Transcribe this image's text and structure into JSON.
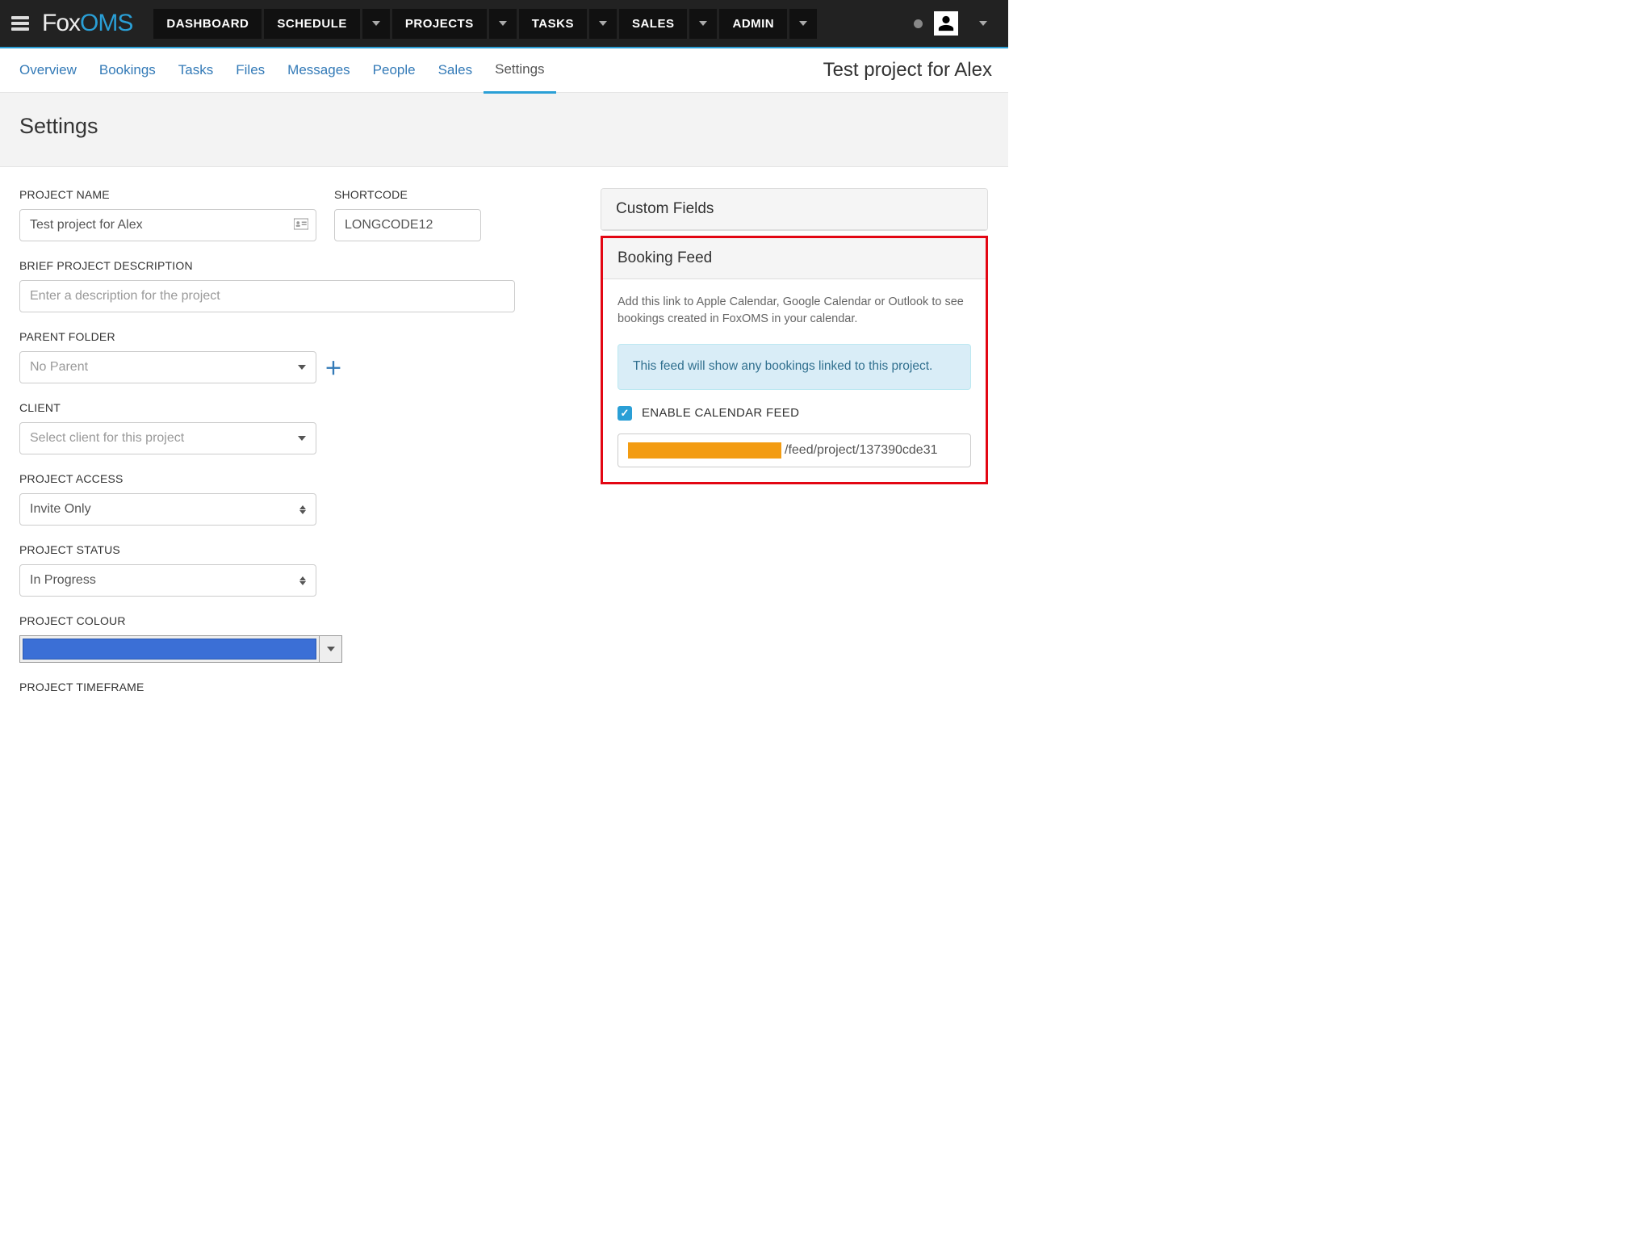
{
  "brand": {
    "part1": "Fox",
    "part2": "OMS"
  },
  "nav": {
    "items": [
      {
        "label": "DASHBOARD",
        "has_caret": false
      },
      {
        "label": "SCHEDULE",
        "has_caret": true
      },
      {
        "label": "PROJECTS",
        "has_caret": true
      },
      {
        "label": "TASKS",
        "has_caret": true
      },
      {
        "label": "SALES",
        "has_caret": true
      },
      {
        "label": "ADMIN",
        "has_caret": true
      }
    ]
  },
  "subtabs": {
    "items": [
      "Overview",
      "Bookings",
      "Tasks",
      "Files",
      "Messages",
      "People",
      "Sales",
      "Settings"
    ],
    "active": "Settings",
    "project_title": "Test project for Alex"
  },
  "page_title": "Settings",
  "form": {
    "project_name_label": "PROJECT NAME",
    "project_name_value": "Test project for Alex",
    "shortcode_label": "SHORTCODE",
    "shortcode_value": "LONGCODE12",
    "desc_label": "BRIEF PROJECT DESCRIPTION",
    "desc_placeholder": "Enter a description for the project",
    "parent_label": "PARENT FOLDER",
    "parent_value": "No Parent",
    "client_label": "CLIENT",
    "client_placeholder": "Select client for this project",
    "access_label": "PROJECT ACCESS",
    "access_value": "Invite Only",
    "status_label": "PROJECT STATUS",
    "status_value": "In Progress",
    "colour_label": "PROJECT COLOUR",
    "colour_value": "#3b6fd6",
    "timeframe_label": "PROJECT TIMEFRAME"
  },
  "panels": {
    "custom_fields_title": "Custom Fields",
    "booking_feed": {
      "title": "Booking Feed",
      "description": "Add this link to Apple Calendar, Google Calendar or Outlook to see bookings created in FoxOMS in your calendar.",
      "info": "This feed will show any bookings linked to this project.",
      "enable_label": "ENABLE CALENDAR FEED",
      "enabled": true,
      "url_tail": "/feed/project/137390cde31"
    }
  }
}
